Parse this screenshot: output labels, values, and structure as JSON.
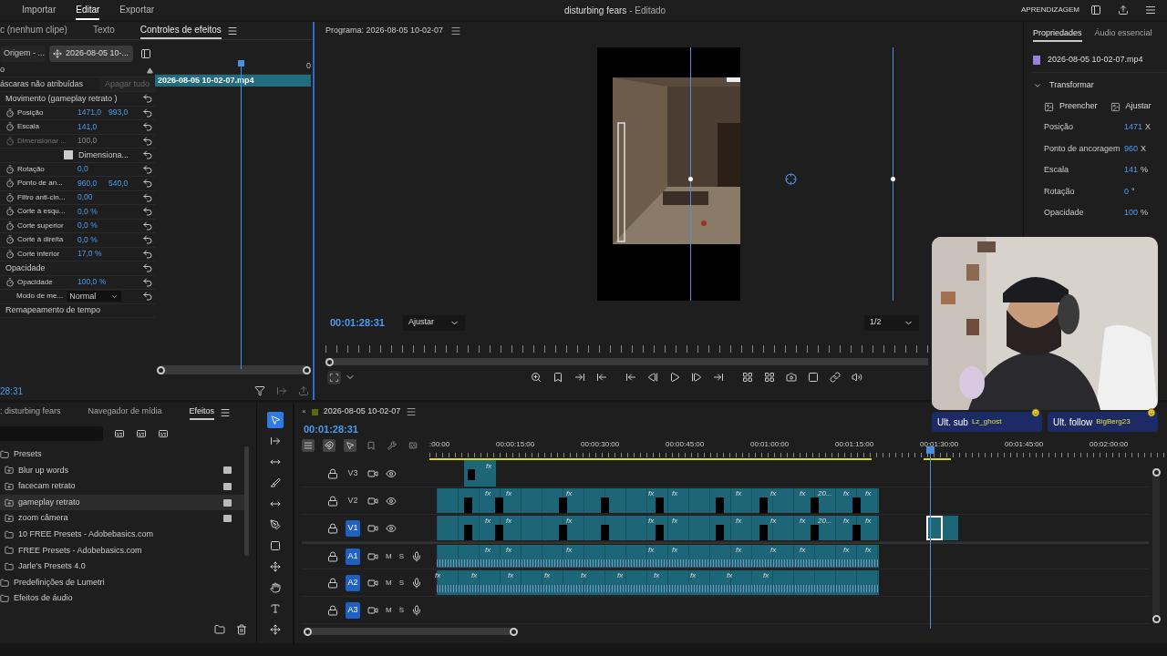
{
  "menu": [
    {
      "label": "Importar",
      "selected": false
    },
    {
      "label": "Editar",
      "selected": true
    },
    {
      "label": "Exportar",
      "selected": false
    }
  ],
  "title": {
    "name": "disturbing fears",
    "status": "- Editado"
  },
  "workspace_label": "APRENDIZAGEM",
  "effect_controls": {
    "tabs": [
      {
        "label": "c (nenhum clipe)",
        "selected": false
      },
      {
        "label": "Texto",
        "selected": false
      },
      {
        "label": "Controles de efeitos",
        "selected": true
      }
    ],
    "source": "Origem - ...",
    "clip": "2026-08-05 10-...",
    "section": "o",
    "masks": "áscaras não atribuídas",
    "clear_all": "Apagar tudo",
    "clip_bar": "2026-08-05 10-02-07.mp4",
    "ruler_label": "0",
    "rows": [
      {
        "kind": "group",
        "label": "Movimento (gameplay retrato )",
        "reset": true
      },
      {
        "kind": "param",
        "label": "Posição",
        "values": [
          "1471,0",
          "993,0"
        ],
        "disabled": false,
        "reset": true
      },
      {
        "kind": "param",
        "label": "Escala",
        "values": [
          "141,0"
        ],
        "disabled": false,
        "reset": true
      },
      {
        "kind": "param",
        "label": "Dimensionar ...",
        "values": [
          "100,0"
        ],
        "disabled": true,
        "reset": true
      },
      {
        "kind": "check",
        "label": "Dimensiona...",
        "checked": true,
        "reset": true
      },
      {
        "kind": "param",
        "label": "Rotação",
        "values": [
          "0,0"
        ],
        "disabled": false,
        "reset": true
      },
      {
        "kind": "param",
        "label": "Ponto de an...",
        "values": [
          "960,0",
          "540,0"
        ],
        "disabled": false,
        "reset": true
      },
      {
        "kind": "param",
        "label": "Filtro anti-cin...",
        "values": [
          "0,00"
        ],
        "disabled": false,
        "reset": true
      },
      {
        "kind": "param",
        "label": "Corte à esqu...",
        "values": [
          "0,0 %"
        ],
        "disabled": false,
        "reset": true
      },
      {
        "kind": "param",
        "label": "Corte superior",
        "values": [
          "0,0 %"
        ],
        "disabled": false,
        "reset": true
      },
      {
        "kind": "param",
        "label": "Corte à direita",
        "values": [
          "0,0 %"
        ],
        "disabled": false,
        "reset": true
      },
      {
        "kind": "param",
        "label": "Corte inferior",
        "values": [
          "17,0 %"
        ],
        "disabled": false,
        "reset": true
      },
      {
        "kind": "group",
        "label": "Opacidade",
        "reset": true
      },
      {
        "kind": "param",
        "label": "Opacidade",
        "values": [
          "100,0 %"
        ],
        "disabled": false,
        "reset": true
      },
      {
        "kind": "select",
        "label": "Modo de me...",
        "value": "Normal",
        "reset": true
      },
      {
        "kind": "group",
        "label": "Remapeamento de tempo",
        "reset": false
      }
    ],
    "timecode": "28:31"
  },
  "program": {
    "title": "Programa: 2026-08-05 10-02-07",
    "timecode": "00:01:28:31",
    "zoom": "Ajustar",
    "resolution": "1/2"
  },
  "properties": {
    "tabs": [
      {
        "label": "Propriedades",
        "selected": true
      },
      {
        "label": "Áudio essencial",
        "selected": false
      }
    ],
    "file": "2026-08-05 10-02-07.mp4",
    "section": "Transformar",
    "expanded": true,
    "fit_buttons": [
      "Preencher",
      "Ajustar"
    ],
    "rows": [
      {
        "label": "Posição",
        "value": "1471",
        "unit": "X"
      },
      {
        "label": "Ponto de ancoragem",
        "value": "960",
        "unit": "X"
      },
      {
        "label": "Escala",
        "value": "141",
        "unit": "%"
      },
      {
        "label": "Rotação",
        "value": "0",
        "unit": "°"
      },
      {
        "label": "Opacidade",
        "value": "100",
        "unit": "%"
      }
    ]
  },
  "webcam": {
    "kind": "picture",
    "badges": [
      {
        "label": "Ult. sub",
        "name": "Lz_ghost"
      },
      {
        "label": "Ult. follow",
        "name": "BigBerg23"
      }
    ]
  },
  "effects_panel": {
    "tabs": [
      {
        "label": ": disturbing fears",
        "selected": false
      },
      {
        "label": "Navegador de mídia",
        "selected": false
      },
      {
        "label": "Efeitos",
        "selected": true
      }
    ],
    "tree": [
      {
        "kind": "folder",
        "label": "Presets",
        "selected": false,
        "children": [
          {
            "kind": "preset",
            "label": "Blur up words",
            "selected": false
          },
          {
            "kind": "preset",
            "label": "facecam retrato",
            "selected": false
          },
          {
            "kind": "preset",
            "label": "gameplay retrato",
            "selected": true
          },
          {
            "kind": "preset",
            "label": "zoom câmera",
            "selected": false
          },
          {
            "kind": "folder",
            "label": "10 FREE Presets - Adobebasics.com",
            "selected": false
          },
          {
            "kind": "folder",
            "label": "FREE Presets - Adobebasics.com",
            "selected": false
          },
          {
            "kind": "folder",
            "label": "Jarle's Presets 4.0",
            "selected": false
          }
        ]
      },
      {
        "kind": "folder",
        "label": "Predefinições de Lumetri",
        "selected": false
      },
      {
        "kind": "folder",
        "label": "Efeitos de áudio",
        "selected": false
      }
    ]
  },
  "tools": [
    {
      "selected": true
    },
    {
      "selected": false
    },
    {
      "selected": false
    },
    {
      "selected": false
    },
    {
      "selected": false
    },
    {
      "selected": false
    },
    {
      "selected": false
    },
    {
      "selected": false
    },
    {
      "selected": false
    },
    {
      "selected": false
    },
    {
      "selected": false
    }
  ],
  "timeline": {
    "close": "×",
    "title": "2026-08-05 10-02-07",
    "timecode": "00:01:28:31",
    "toggles": [
      {
        "on": true
      },
      {
        "on": true
      },
      {
        "on": true
      },
      {
        "on": false
      },
      {
        "on": false
      },
      {
        "on": false
      }
    ],
    "ruler": [
      ":00:00",
      "00:00:15:00",
      "00:00:30:00",
      "00:00:45:00",
      "00:01:00:00",
      "00:01:15:00",
      "00:01:30:00",
      "00:01:45:00",
      "00:02:00:00"
    ],
    "tracks": [
      {
        "name": "V3",
        "kind": "video",
        "selected": false,
        "clips": [
          {
            "label": "fx"
          }
        ]
      },
      {
        "name": "V2",
        "kind": "video",
        "selected": false,
        "clips": [
          {
            "label": "fx"
          },
          {
            "label": "fx"
          },
          {
            "label": "fx"
          },
          {
            "label": "fx"
          },
          {
            "label": "fx"
          },
          {
            "label": "fx"
          },
          {
            "label": "fx"
          },
          {
            "label": "fx"
          },
          {
            "label": "20..."
          },
          {
            "label": "fx"
          },
          {
            "label": "fx"
          }
        ]
      },
      {
        "name": "V1",
        "kind": "video",
        "selected": true,
        "tail_clip": true,
        "clips": [
          {
            "label": "fx"
          },
          {
            "label": "fx"
          },
          {
            "label": "fx"
          },
          {
            "label": "fx"
          },
          {
            "label": "fx"
          },
          {
            "label": "fx"
          },
          {
            "label": "fx"
          },
          {
            "label": "fx"
          },
          {
            "label": "20..."
          },
          {
            "label": "fx"
          },
          {
            "label": "fx"
          }
        ]
      },
      {
        "name": "A1",
        "kind": "audio",
        "selected": true,
        "mute": "M",
        "solo": "S",
        "clips": [
          {
            "label": "fx"
          },
          {
            "label": "fx"
          },
          {
            "label": "fx"
          },
          {
            "label": "fx"
          },
          {
            "label": "fx"
          },
          {
            "label": "fx"
          },
          {
            "label": "fx"
          },
          {
            "label": "fx"
          },
          {
            "label": "fx"
          },
          {
            "label": "fx"
          }
        ]
      },
      {
        "name": "A2",
        "kind": "audio",
        "selected": true,
        "mute": "M",
        "solo": "S",
        "clips": [
          {
            "label": "fx"
          },
          {
            "label": "fx"
          },
          {
            "label": "fx"
          },
          {
            "label": "fx"
          },
          {
            "label": "fx"
          },
          {
            "label": "fx"
          },
          {
            "label": "fx"
          },
          {
            "label": "fx"
          },
          {
            "label": "fx"
          },
          {
            "label": "fx"
          }
        ]
      },
      {
        "name": "A3",
        "kind": "audio",
        "selected": true,
        "mute": "M",
        "solo": "S"
      }
    ]
  }
}
